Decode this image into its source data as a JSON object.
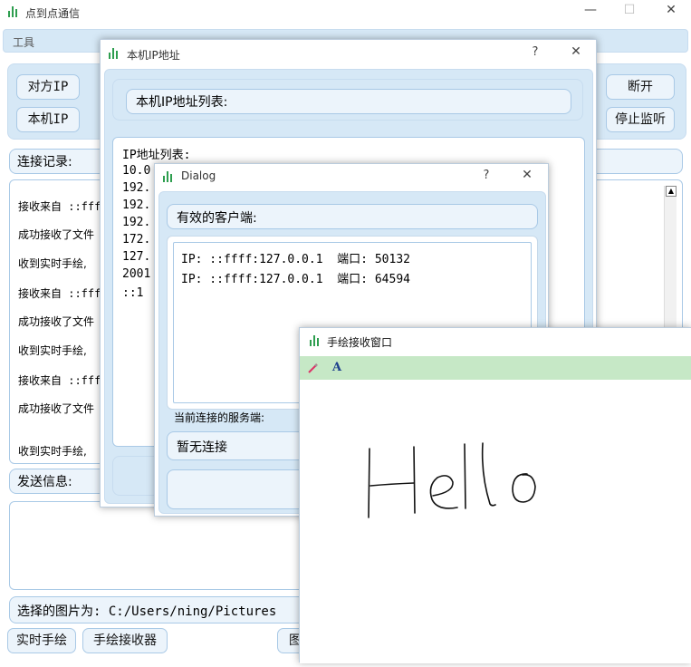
{
  "main": {
    "title": "点到点通信",
    "menu_tools": "工具",
    "btn_peer_ip": "对方IP",
    "btn_local_ip": "本机IP",
    "btn_disconnect": "断开",
    "btn_stop_listen": "停止监听",
    "log_label": "连接记录:",
    "log_lines": [
      "接收来自 ::fff",
      "成功接收了文件",
      "收到实时手绘,",
      "接收来自 ::fff",
      "成功接收了文件",
      "收到实时手绘,",
      "接收来自 ::fff",
      "成功接收了文件",
      "收到实时手绘,"
    ],
    "send_label": "发送信息:",
    "selected_image": "选择的图片为: C:/Users/ning/Pictures",
    "btn_realtime_draw": "实时手绘",
    "btn_draw_receiver": "手绘接收器",
    "btn_partial": "图"
  },
  "ipwin": {
    "title": "本机IP地址",
    "help": "?",
    "close": "✕",
    "header": "本机IP地址列表:",
    "list_title": "IP地址列表:",
    "list_lines": [
      "10.0",
      "192.",
      "192.",
      "192.",
      "172.",
      "127.",
      "2001",
      "::1"
    ]
  },
  "dialog": {
    "title": "Dialog",
    "help": "?",
    "close": "✕",
    "clients_label": "有效的客户端:",
    "clients": [
      "IP: ::ffff:127.0.0.1  端口: 50132",
      "IP: ::ffff:127.0.0.1  端口: 64594"
    ],
    "server_label": "当前连接的服务端:",
    "server_value": "暂无连接"
  },
  "drawwin": {
    "title": "手绘接收窗口",
    "tool_pen": "pen-icon",
    "tool_text": "A",
    "toolbar_color": "#c6e8c6"
  },
  "colors": {
    "panel": "#d6e8f6",
    "button": "#ecf4fb",
    "logo": "#2e9e4f"
  }
}
